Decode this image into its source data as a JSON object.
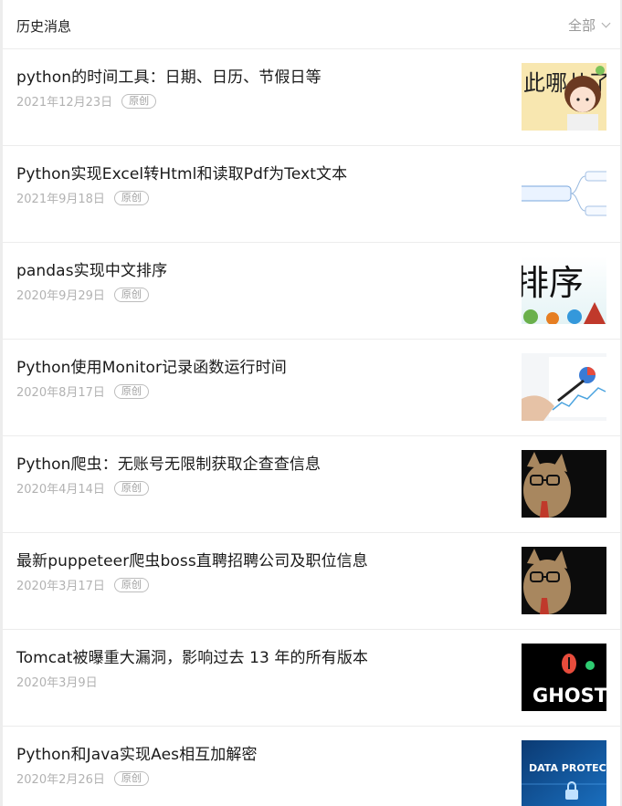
{
  "header": {
    "title": "历史消息",
    "filter_label": "全部"
  },
  "articles": [
    {
      "title": "python的时间工具：日期、日历、节假日等",
      "date": "2021年12月23日",
      "tag": "原创",
      "thumb_text": "此哪儿了",
      "thumb_icon": "cartoon-girl-thumbnail"
    },
    {
      "title": "Python实现Excel转Html和读取Pdf为Text文本",
      "date": "2021年9月18日",
      "tag": "原创",
      "thumb_icon": "mindmap-thumbnail"
    },
    {
      "title": "pandas实现中文排序",
      "date": "2020年9月29日",
      "tag": "原创",
      "thumb_text": "排序",
      "thumb_icon": "sorting-calligraphy-thumbnail"
    },
    {
      "title": "Python使用Monitor记录函数运行时间",
      "date": "2020年8月17日",
      "tag": "原创",
      "thumb_icon": "chart-pen-thumbnail"
    },
    {
      "title": "Python爬虫：无账号无限制获取企查查信息",
      "date": "2020年4月14日",
      "tag": "原创",
      "thumb_icon": "cat-glasses-thumbnail"
    },
    {
      "title": "最新puppeteer爬虫boss直聘招聘公司及职位信息",
      "date": "2020年3月17日",
      "tag": "原创",
      "thumb_icon": "cat-glasses-thumbnail"
    },
    {
      "title": "Tomcat被曝重大漏洞，影响过去 13 年的所有版本",
      "date": "2020年3月9日",
      "thumb_text": "GHOSTC",
      "thumb_icon": "ghostcat-thumbnail"
    },
    {
      "title": "Python和Java实现Aes相互加解密",
      "date": "2020年2月26日",
      "tag": "原创",
      "thumb_text": "DATA PROTECTION",
      "thumb_icon": "data-protection-thumbnail"
    }
  ]
}
